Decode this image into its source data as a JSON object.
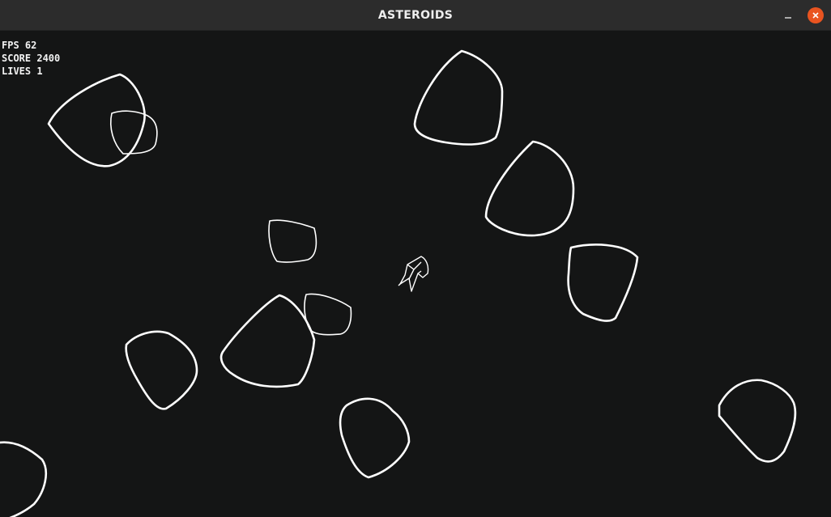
{
  "window": {
    "title": "ASTEROIDS",
    "controls": {
      "minimize_icon": "minimize-icon",
      "close_icon": "close-icon"
    }
  },
  "hud": {
    "fps_text": "FPS 62",
    "score_text": "SCORE 2400",
    "lives_text": "LIVES 1"
  },
  "colors": {
    "background": "#141515",
    "titlebar": "#2c2c2c",
    "close_button": "#e95420",
    "outline": "#ffffff"
  }
}
